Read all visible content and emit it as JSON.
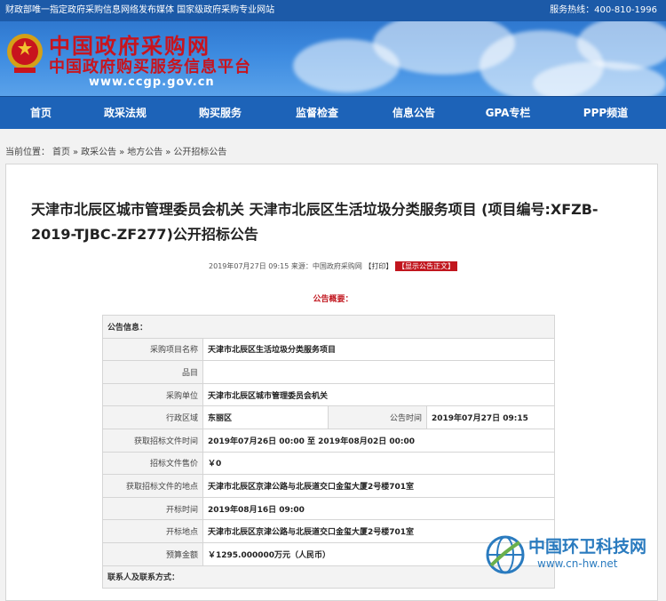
{
  "topbar": {
    "left": "财政部唯一指定政府采购信息网络发布媒体 国家级政府采购专业网站",
    "right": "服务热线：400-810-1996"
  },
  "brand": {
    "line1": "中国政府采购网",
    "line2": "中国政府购买服务信息平台",
    "url": "www.ccgp.gov.cn"
  },
  "nav": [
    "首页",
    "政采法规",
    "购买服务",
    "监督检查",
    "信息公告",
    "GPA专栏",
    "PPP频道"
  ],
  "breadcrumb": {
    "prefix": "当前位置：",
    "items": [
      "首页",
      "政采公告",
      "地方公告",
      "公开招标公告"
    ],
    "separator": "»"
  },
  "article": {
    "title": "天津市北辰区城市管理委员会机关 天津市北辰区生活垃圾分类服务项目 (项目编号:XFZB-2019-TJBC-ZF277)公开招标公告",
    "meta": "2019年07月27日 09:15 来源：中国政府采购网",
    "print": "【打印】",
    "show": "【显示公告正文】",
    "summary": "公告概要："
  },
  "table": {
    "section1": "公告信息：",
    "rows": [
      {
        "label": "采购项目名称",
        "value": "天津市北辰区生活垃圾分类服务项目"
      },
      {
        "label": "品目",
        "value": ""
      },
      {
        "label": "采购单位",
        "value": "天津市北辰区城市管理委员会机关"
      },
      {
        "label": "行政区域",
        "value": "东丽区",
        "label2": "公告时间",
        "value2": "2019年07月27日 09:15"
      },
      {
        "label": "获取招标文件时间",
        "value": "2019年07月26日 00:00 至 2019年08月02日 00:00"
      },
      {
        "label": "招标文件售价",
        "value": "￥0"
      },
      {
        "label": "获取招标文件的地点",
        "value": "天津市北辰区京津公路与北辰道交口金玺大厦2号楼701室"
      },
      {
        "label": "开标时间",
        "value": "2019年08月16日 09:00"
      },
      {
        "label": "开标地点",
        "value": "天津市北辰区京津公路与北辰道交口金玺大厦2号楼701室"
      },
      {
        "label": "预算金额",
        "value": "￥1295.000000万元（人民币）"
      }
    ],
    "section2": "联系人及联系方式："
  },
  "watermark": {
    "name": "中国环卫科技网",
    "url": "www.cn-hw.net"
  },
  "colors": {
    "topbar": "#1c5aa8",
    "nav": "#1d63b8",
    "brand_red": "#c8141e",
    "accent_red": "#c1161e"
  }
}
